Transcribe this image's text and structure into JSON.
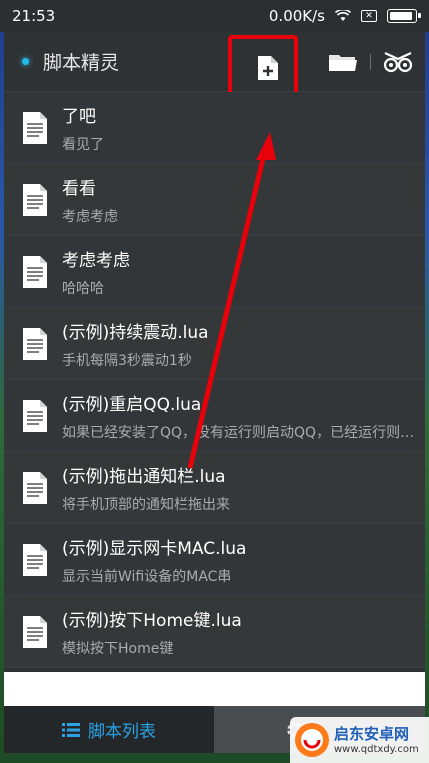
{
  "status_bar": {
    "time": "21:53",
    "speed": "0.00K/s",
    "battery_level": 0.95
  },
  "app_bar": {
    "title": "脚本精灵"
  },
  "scripts": [
    {
      "title": "了吧",
      "subtitle": "看见了"
    },
    {
      "title": "看看",
      "subtitle": "考虑考虑"
    },
    {
      "title": "考虑考虑",
      "subtitle": "哈哈哈"
    },
    {
      "title": "(示例)持续震动.lua",
      "subtitle": "手机每隔3秒震动1秒"
    },
    {
      "title": "(示例)重启QQ.lua",
      "subtitle": "如果已经安装了QQ，没有运行则启动QQ，已经运行则重启QQ"
    },
    {
      "title": "(示例)拖出通知栏.lua",
      "subtitle": "将手机顶部的通知栏拖出来"
    },
    {
      "title": "(示例)显示网卡MAC.lua",
      "subtitle": "显示当前Wifi设备的MAC串"
    },
    {
      "title": "(示例)按下Home键.lua",
      "subtitle": "模拟按下Home键"
    }
  ],
  "bottom_tabs": {
    "scripts_label": "脚本列表"
  },
  "watermark": {
    "name": "启东安卓网",
    "url": "www.qdtxdy.com"
  },
  "colors": {
    "accent": "#29a3e6",
    "highlight": "#e8000b"
  },
  "icons": [
    "wifi-icon",
    "sim-icon",
    "battery-icon",
    "new-file-icon",
    "folder-icon",
    "recorder-icon",
    "document-icon",
    "list-icon",
    "gear-icon"
  ]
}
